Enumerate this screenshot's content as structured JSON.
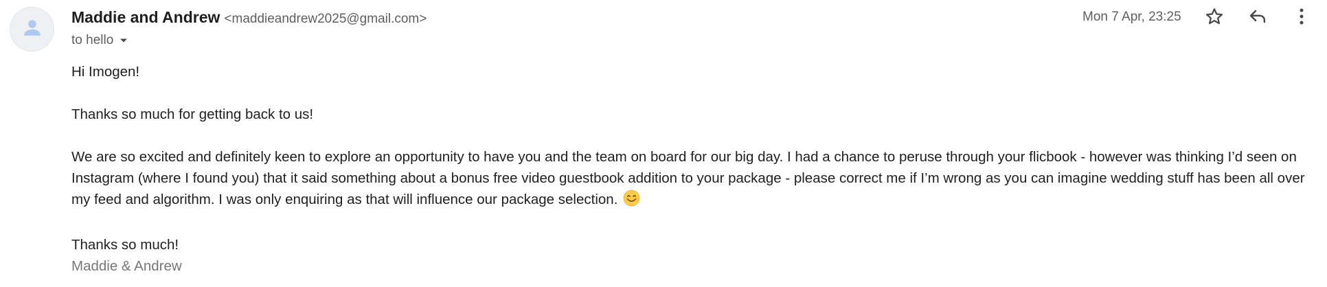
{
  "sender": {
    "name": "Maddie and Andrew",
    "email": "<maddieandrew2025@gmail.com>"
  },
  "recipient": {
    "label": "to hello"
  },
  "date": "Mon 7 Apr, 23:25",
  "icons": {
    "avatar": "person-icon",
    "caret": "caret-down-icon",
    "star": "star-icon",
    "reply": "reply-icon",
    "more": "more-vert-icon",
    "emoji": "smiling-face-icon"
  },
  "colors": {
    "avatar_bg": "#eef0f3",
    "avatar_person": "#aec8f2",
    "secondary_text": "#5e5e5e",
    "signature": "#777777"
  },
  "body": {
    "greeting": "Hi Imogen!",
    "para1": "Thanks so much for getting back to us!",
    "para2": "We are so excited and definitely keen to explore an opportunity to have you and the team on board for our big day. I had a chance to peruse through your flicbook - however was thinking I’d seen on Instagram (where I found you) that it said something about a bonus free video guestbook addition to your package - please correct me if I’m wrong as you can imagine wedding stuff has been all over my feed and algorithm. I was only enquiring as that will influence our package selection.",
    "closing": "Thanks so much!",
    "signature": "Maddie & Andrew"
  }
}
